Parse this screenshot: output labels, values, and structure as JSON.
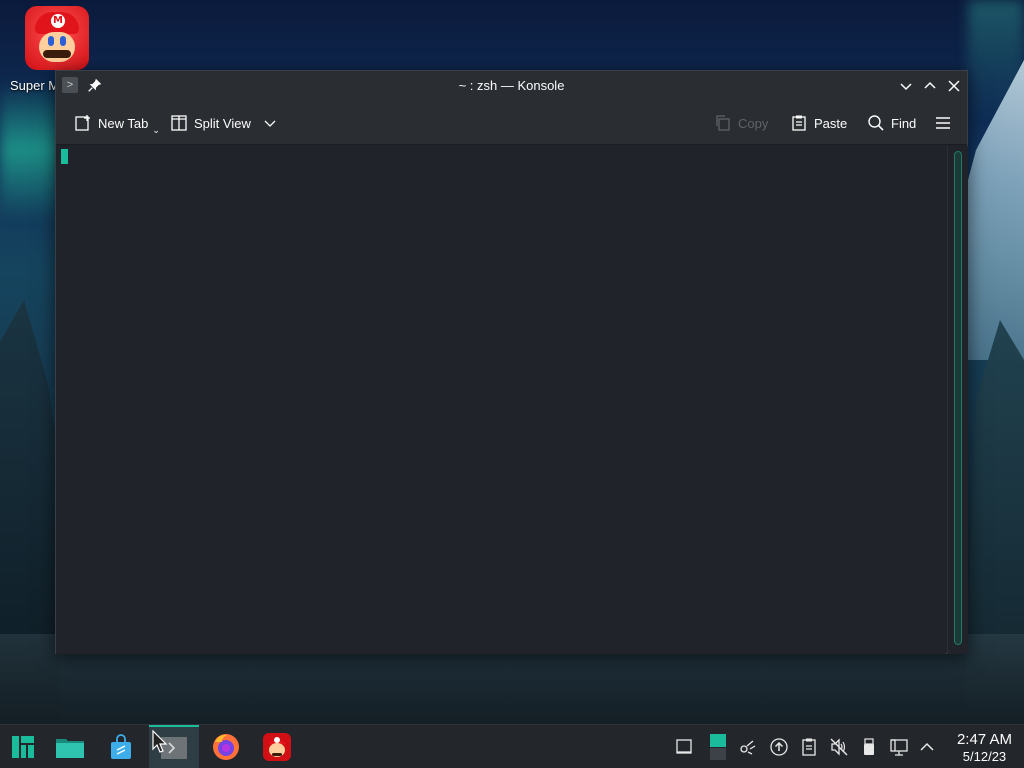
{
  "desktop": {
    "icons": [
      {
        "label": "Super M"
      }
    ]
  },
  "window": {
    "title": "~ : zsh — Konsole",
    "toolbar": {
      "new_tab": "New Tab",
      "split_view": "Split View",
      "copy": "Copy",
      "paste": "Paste",
      "find": "Find"
    }
  },
  "taskbar": {
    "apps": [
      "application-launcher",
      "file-manager",
      "discover-store",
      "konsole",
      "firefox",
      "super-mario"
    ],
    "active_app": "konsole",
    "clock": {
      "time": "2:47 AM",
      "date": "5/12/23"
    }
  },
  "colors": {
    "accent": "#1abc9c",
    "window_bg": "#202329",
    "titlebar_bg": "#2a2e32",
    "taskbar_bg": "#23262b"
  }
}
